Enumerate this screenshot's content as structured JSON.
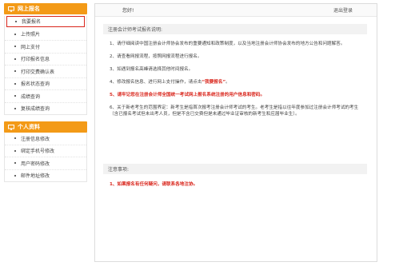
{
  "sidebar": {
    "section1": {
      "title": "网上报名",
      "items": [
        "我要报名",
        "上传照片",
        "网上支付",
        "打印报名信息",
        "打印交费确认表",
        "报名状态查询",
        "成绩查询",
        "复核成绩查询"
      ]
    },
    "section2": {
      "title": "个人资料",
      "items": [
        "注册信息修改",
        "绑定手机号修改",
        "用户密码修改",
        "邮件地址修改"
      ]
    }
  },
  "topbar": {
    "greeting": "您好!",
    "logout": "退出登录"
  },
  "instructions": {
    "title": "注册会计师考试报名说明:",
    "p1": "1、请仔细阅读中国注册会计师协会发布的重要通知和政策制度，以及当地注册会计师协会发布的地方公告和问题解答。",
    "p2": "2、请查看网报流程，按照网报流程进行报名。",
    "p3": "3、如遇到报名高峰请选择其他时间报名。",
    "p4_prefix": "4、修改报名信息、进行网上支付操作，请点击",
    "p4_link": "“我要报名”",
    "p4_suffix": "。",
    "p5": "5、请牢记您在注册会计师全国统一考试网上报名系统注册的用户信息和密码。",
    "p6": "6、关于新老考生的范围界定：新考生是指首次报考注册会计师考试的考生。老考生是指以往年度参加过注册会计师考试的考生（含已报名考试但未出考人员，但是不含已交费但是未通过毕业证审核的新考生和应届毕业生）。"
  },
  "notes": {
    "title": "注意事项:",
    "n1": "1、如果报名有任何疑问，请联系各地注协。"
  },
  "colors": {
    "accent": "#f39a17",
    "red": "#d9261c"
  }
}
